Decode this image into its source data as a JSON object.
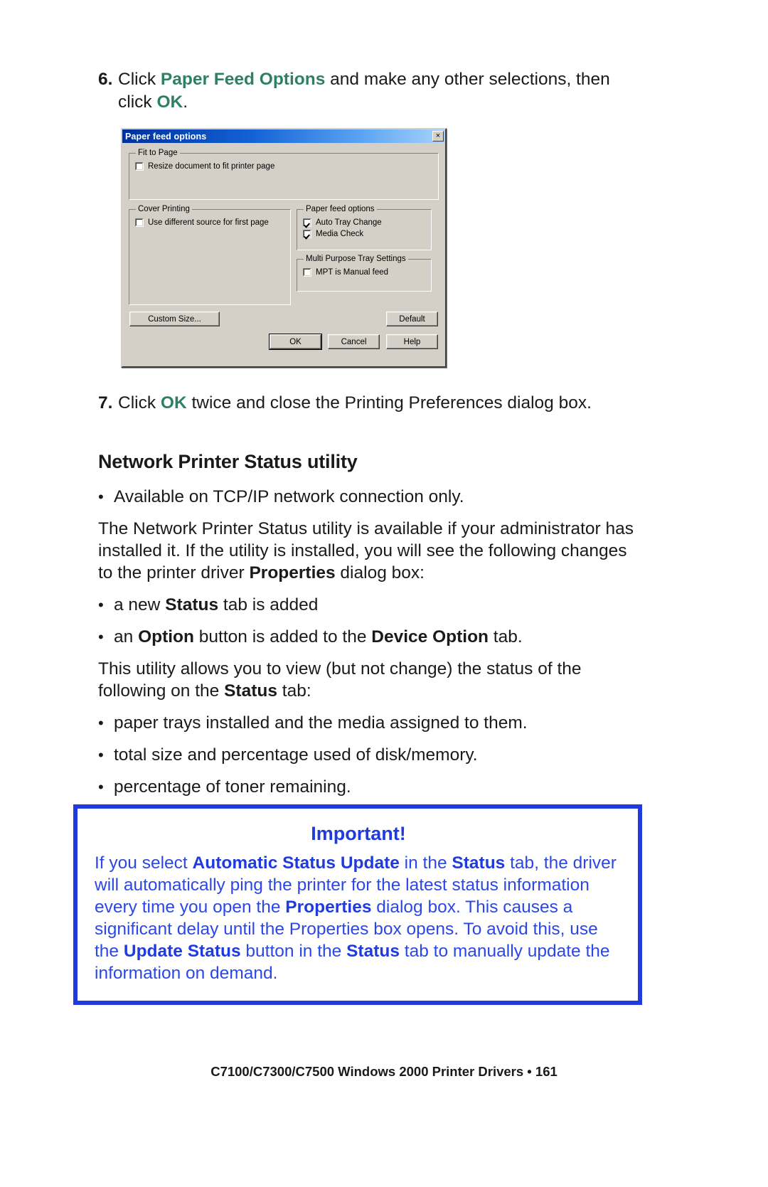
{
  "page": {
    "footer": "C7100/C7300/C7500 Windows 2000 Printer Drivers • 161",
    "accent_green": "#2f7f63",
    "accent_blue": "#1f3bdd"
  },
  "steps": [
    {
      "number": "6.",
      "parts": [
        {
          "text": "Click ",
          "style": "normal"
        },
        {
          "text": "Paper Feed Options",
          "style": "green"
        },
        {
          "text": " and make any other selections, then click ",
          "style": "normal"
        },
        {
          "text": "OK",
          "style": "green"
        },
        {
          "text": ".",
          "style": "normal"
        }
      ]
    },
    {
      "number": "7.",
      "parts": [
        {
          "text": "Click ",
          "style": "normal"
        },
        {
          "text": "OK",
          "style": "green"
        },
        {
          "text": " twice and close the Printing Preferences dialog box.",
          "style": "normal"
        }
      ]
    }
  ],
  "step6": {
    "number": "6.",
    "lead": "Click ",
    "link1": "Paper Feed Options",
    "mid": " and make any other selections, then click ",
    "link2": "OK",
    "tail": "."
  },
  "step7": {
    "number": "7.",
    "lead": "Click ",
    "link1": "OK",
    "tail": " twice and close the Printing Preferences dialog box."
  },
  "dialog": {
    "title": "Paper feed options",
    "close_label": "×",
    "groups": {
      "fit_to_page": {
        "legend": "Fit to Page",
        "checkbox": {
          "label": "Resize document to fit printer page",
          "checked": false
        }
      },
      "cover_printing": {
        "legend": "Cover Printing",
        "checkbox": {
          "label": "Use different source for first page",
          "checked": false
        }
      },
      "paper_feed_options": {
        "legend": "Paper feed options",
        "checkboxes": [
          {
            "label": "Auto Tray Change",
            "checked": true
          },
          {
            "label": "Media Check",
            "checked": true
          }
        ]
      },
      "multi_purpose_tray": {
        "legend": "Multi Purpose Tray Settings",
        "checkbox": {
          "label": "MPT is Manual feed",
          "checked": false
        }
      }
    },
    "buttons": {
      "custom_size": "Custom Size...",
      "default": "Default",
      "ok": "OK",
      "cancel": "Cancel",
      "help": "Help"
    }
  },
  "section": {
    "heading": "Network Printer Status utility",
    "bullet_tcpip": "Available on TCP/IP network connection only.",
    "para1": {
      "a": "The Network Printer Status utility is available if your administrator has installed it. If the utility is installed, you will see the following changes to the printer driver ",
      "bold": "Properties",
      "b": " dialog box:"
    },
    "bullet_status_tab": {
      "a": "a new ",
      "bold": "Status",
      "b": " tab is added"
    },
    "bullet_option_button": {
      "a": "an ",
      "bold1": "Option",
      "b": " button is added to the ",
      "bold2": "Device Option",
      "c": " tab."
    },
    "para2": {
      "a": "This utility allows you to view (but not change) the status of the following on the ",
      "bold": "Status",
      "b": " tab:"
    },
    "bullet_trays": "paper trays installed and the media assigned to them.",
    "bullet_disk": "total size and percentage used of disk/memory.",
    "bullet_toner": "percentage of toner remaining."
  },
  "important": {
    "title": "Important!",
    "t1": "If you select ",
    "b1": "Automatic Status Update",
    "t2": " in the ",
    "b2": "Status",
    "t3": " tab, the driver will automatically ping the printer for the latest status information every time you open the ",
    "b3": "Properties",
    "t4": " dialog box. This causes a significant delay until the Properties box opens. To avoid this, use the ",
    "b4": "Update Status",
    "t5": " button in the ",
    "b5": "Status",
    "t6": " tab to manually update the information on demand."
  }
}
